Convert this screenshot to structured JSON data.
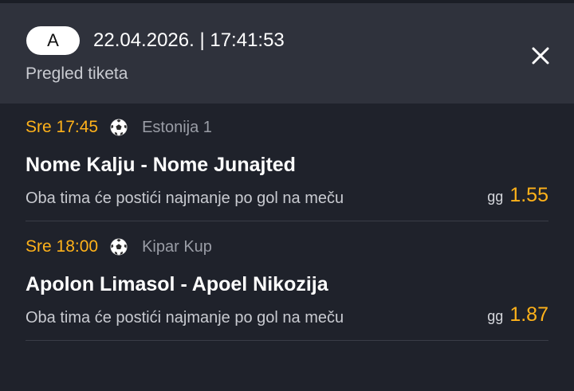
{
  "header": {
    "badge": "A",
    "datetime": "22.04.2026. | 17:41:53",
    "subtitle": "Pregled tiketa",
    "close_icon": "close-icon"
  },
  "events": [
    {
      "time": "Sre 17:45",
      "sport_icon": "soccer-ball-icon",
      "league": "Estonija 1",
      "match": "Nome Kalju - Nome Junajted",
      "market": "Oba tima će postići najmanje po gol na meču",
      "pick": "gg",
      "odds": "1.55"
    },
    {
      "time": "Sre 18:00",
      "sport_icon": "soccer-ball-icon",
      "league": "Kipar Kup",
      "match": "Apolon Limasol - Apoel Nikozija",
      "market": "Oba tima će postići najmanje po gol na meču",
      "pick": "gg",
      "odds": "1.87"
    }
  ],
  "colors": {
    "background": "#1f222b",
    "header": "#2f323c",
    "accent": "#ffb21a"
  }
}
